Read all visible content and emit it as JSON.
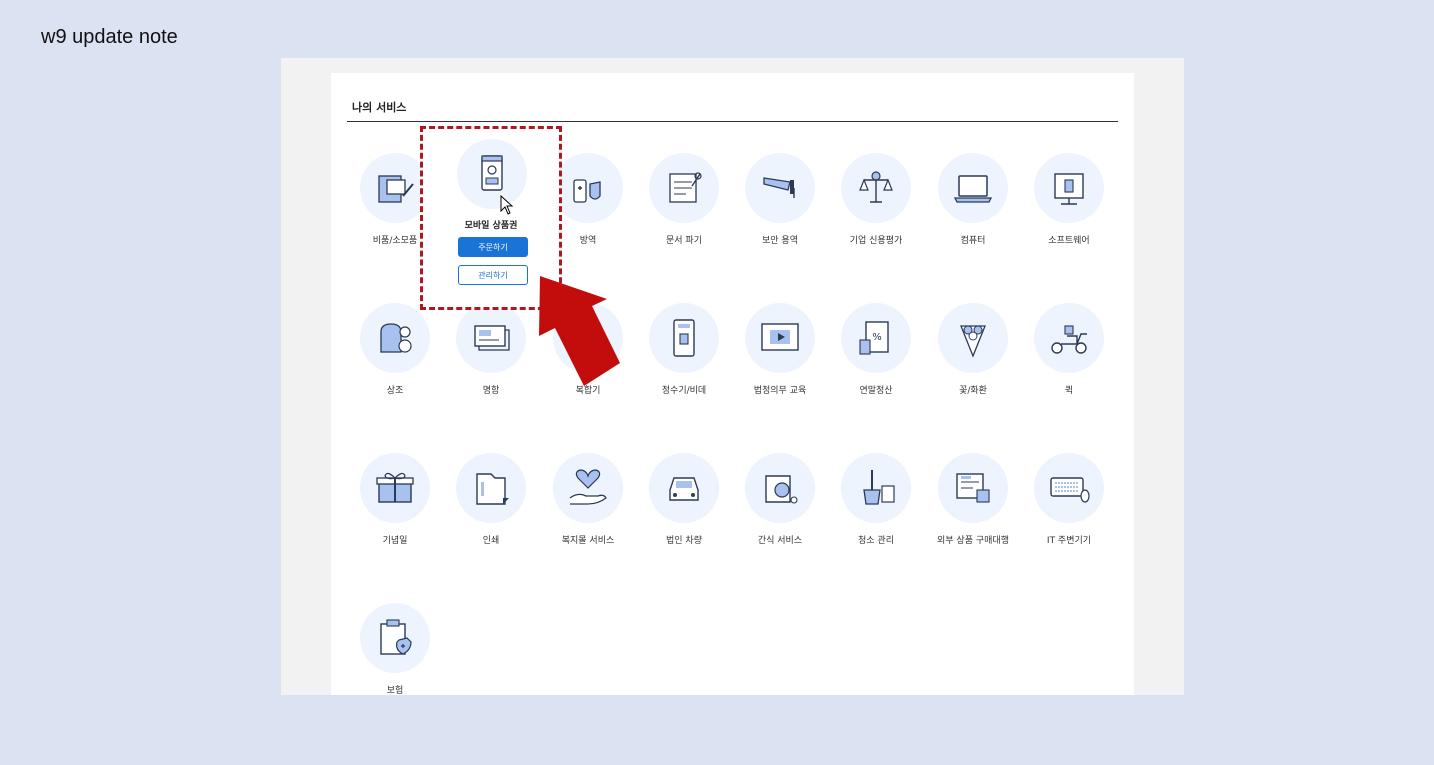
{
  "note": {
    "title": "w9 update note"
  },
  "section": {
    "title": "나의 서비스"
  },
  "popup": {
    "title": "모바일 상품권",
    "order_label": "주문하기",
    "manage_label": "관리하기",
    "icon": "mobile-voucher-icon"
  },
  "services": [
    {
      "label": "비품/소모품",
      "icon": "supplies-icon"
    },
    {
      "label": "방역",
      "icon": "disinfection-icon"
    },
    {
      "label": "문서 파기",
      "icon": "document-shred-icon"
    },
    {
      "label": "보안 용역",
      "icon": "security-camera-icon"
    },
    {
      "label": "기업 신용평가",
      "icon": "scale-icon"
    },
    {
      "label": "컴퓨터",
      "icon": "laptop-icon"
    },
    {
      "label": "소프트웨어",
      "icon": "software-icon"
    },
    {
      "label": "상조",
      "icon": "funeral-icon"
    },
    {
      "label": "명함",
      "icon": "business-card-icon"
    },
    {
      "label": "복합기",
      "icon": "printer-icon"
    },
    {
      "label": "정수기/비데",
      "icon": "water-purifier-icon"
    },
    {
      "label": "법정의무 교육",
      "icon": "video-lecture-icon"
    },
    {
      "label": "연말정산",
      "icon": "tax-document-icon"
    },
    {
      "label": "꽃/화환",
      "icon": "flower-icon"
    },
    {
      "label": "퀵",
      "icon": "scooter-icon"
    },
    {
      "label": "기념일",
      "icon": "gift-icon"
    },
    {
      "label": "인쇄",
      "icon": "folder-icon"
    },
    {
      "label": "복지몰 서비스",
      "icon": "heart-hand-icon"
    },
    {
      "label": "법인 차량",
      "icon": "car-icon"
    },
    {
      "label": "간식 서비스",
      "icon": "snack-icon"
    },
    {
      "label": "청소 관리",
      "icon": "cleaning-icon"
    },
    {
      "label": "외부 상품 구매대행",
      "icon": "purchase-agent-icon"
    },
    {
      "label": "IT 주변기기",
      "icon": "keyboard-icon"
    },
    {
      "label": "보험",
      "icon": "insurance-icon"
    }
  ],
  "colors": {
    "accent": "#1a73d6",
    "highlight": "#b0181f",
    "icon_bg": "#edf4fd",
    "icon_line": "#2b3a55",
    "icon_fill": "#a8c1ee",
    "page_bg": "#dbe3f3"
  }
}
